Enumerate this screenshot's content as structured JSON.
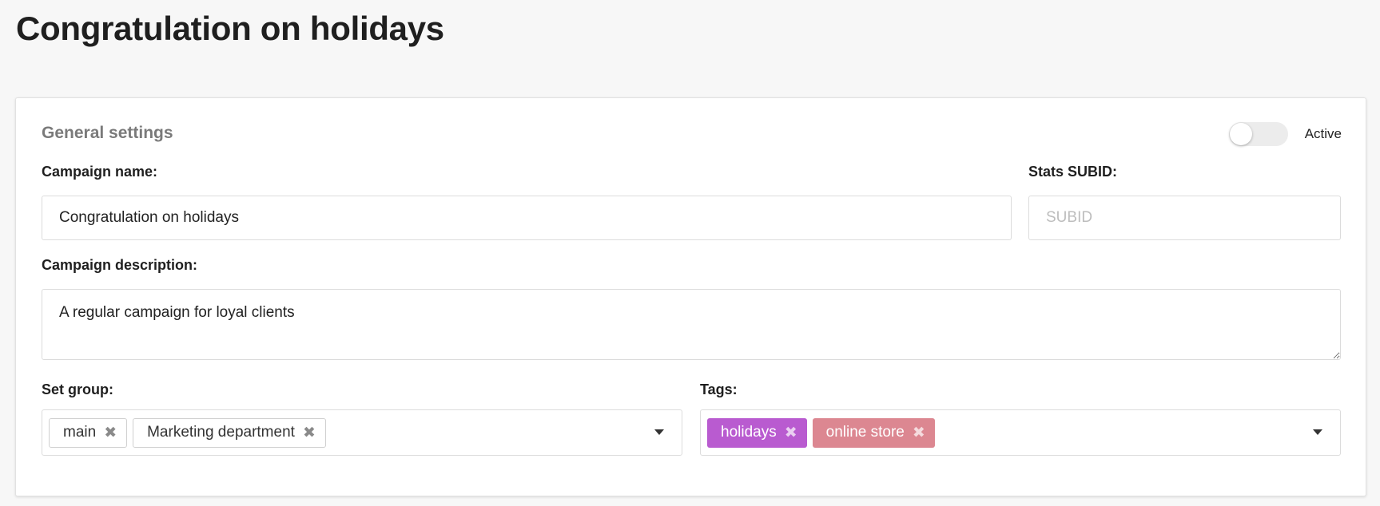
{
  "page": {
    "title": "Congratulation on holidays"
  },
  "general_settings": {
    "section_title": "General settings",
    "active_toggle": {
      "label": "Active",
      "on": false
    },
    "campaign_name": {
      "label": "Campaign name:",
      "value": "Congratulation on holidays"
    },
    "stats_subid": {
      "label": "Stats SUBID:",
      "value": "",
      "placeholder": "SUBID"
    },
    "campaign_description": {
      "label": "Campaign description:",
      "value": "A regular campaign for loyal clients"
    },
    "set_group": {
      "label": "Set group:",
      "chips": [
        {
          "label": "main"
        },
        {
          "label": "Marketing department"
        }
      ],
      "remove_icon": "✖"
    },
    "tags": {
      "label": "Tags:",
      "chips": [
        {
          "label": "holidays",
          "color": "#b95bd0"
        },
        {
          "label": "online store",
          "color": "#dc8791"
        }
      ],
      "remove_icon": "✖"
    }
  }
}
